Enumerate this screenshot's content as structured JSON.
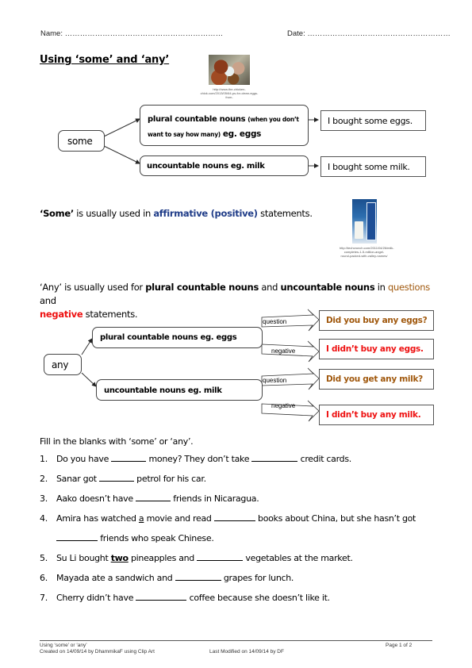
{
  "header": {
    "name_label": "Name: ………………………………………………………",
    "date_label": "Date: …………………………………………………"
  },
  "title": "Using ‘some’ and ‘any’",
  "images": {
    "eggs": {
      "alt": "eggs-photo",
      "caption": "http://www.the-chicken-chick.com/2013/05/64-ps-for-clean-eggs-from-"
    },
    "milk": {
      "alt": "milk-photo",
      "caption": "http://techcrunch.com/2011/04/26/milk-completes-1-5-million-angel-round-packed-with-valley-names/"
    }
  },
  "some_diagram": {
    "root": "some",
    "branch1": {
      "bold": "plural countable nouns",
      "small": "(when you don’t want to say how many)",
      "example": "eg. eggs"
    },
    "branch2": {
      "text": "uncountable nouns eg. milk"
    },
    "result1": "I bought some eggs.",
    "result2": "I bought some milk."
  },
  "some_rule": {
    "quoted": "‘Some’",
    "mid": " is usually used in ",
    "highlight": "affirmative (positive)",
    "end": " statements."
  },
  "any_rule": {
    "p1": "‘Any’ is usually used for ",
    "b1": "plural countable nouns",
    "p2": " and ",
    "b2": "uncountable nouns",
    "p3": " in ",
    "q": "questions",
    "p4": " and",
    "neg": "negative",
    "p5": " statements."
  },
  "any_diagram": {
    "root": "any",
    "branch1": "plural countable nouns eg. eggs",
    "branch2": "uncountable nouns eg. milk",
    "arrow_question": "question",
    "arrow_negative": "negative",
    "results": [
      {
        "text": "Did you buy any eggs?",
        "type": "question",
        "color": "#a0580d"
      },
      {
        "text": "I didn’t buy any eggs.",
        "type": "negative",
        "color": "#ee1111"
      },
      {
        "text": "Did you get any milk?",
        "type": "question",
        "color": "#a0580d"
      },
      {
        "text": "I didn’t buy any milk.",
        "type": "negative",
        "color": "#ee1111"
      }
    ]
  },
  "exercise": {
    "instruction": "Fill in the blanks with ‘some’ or ‘any’.",
    "items": [
      {
        "num": "1.",
        "a": "Do you have ",
        "b": " money? They don’t take ",
        "c": " credit cards."
      },
      {
        "num": "2.",
        "a": "Sanar got ",
        "b": " petrol for his car."
      },
      {
        "num": "3.",
        "a": "Aako doesn’t have ",
        "b": " friends in Nicaragua."
      },
      {
        "num": "4.",
        "a": "Amira has watched ",
        "u": "a",
        "a2": " movie and read ",
        "b": " books about China, but she hasn’t got",
        "c": " friends who speak Chinese."
      },
      {
        "num": "5.",
        "a": "Su Li bought ",
        "u": "two",
        "a2": " pineapples and ",
        "b": " vegetables at the market."
      },
      {
        "num": "6.",
        "a": "Mayada ate a sandwich and ",
        "b": " grapes for lunch."
      },
      {
        "num": "7.",
        "a": "Cherry didn’t have ",
        "b": " coffee because she doesn’t like it."
      }
    ]
  },
  "footer": {
    "doc_title": "Using ‘some’ or ‘any’",
    "created": "Created on 14/09/14 by DhammikaF using Clip Art",
    "modified": "Last Modified on 14/09/14 by DF",
    "page": "Page 1 of 2"
  },
  "colors": {
    "affirmative": "#1f3c88",
    "question": "#a0580d",
    "negative": "#ee1111"
  }
}
